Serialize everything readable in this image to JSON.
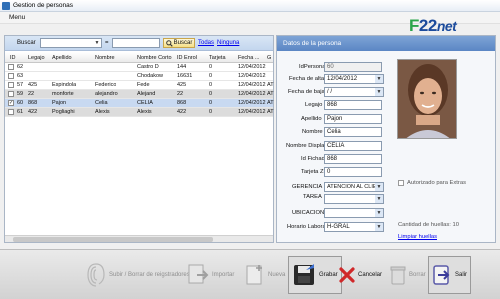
{
  "window": {
    "title": "Gestion de personas"
  },
  "menu": {
    "items": [
      "Menu"
    ]
  },
  "logo": {
    "text_f": "F",
    "text_22": "22",
    "text_net": "net"
  },
  "search": {
    "label": "Buscar",
    "field_value": "",
    "operator": "=",
    "value": "",
    "button_label": "Buscar",
    "link_all": "Todas",
    "link_none": "Ninguna"
  },
  "grid": {
    "columns": [
      "ID",
      "Legajo",
      "Apellido",
      "Nombre",
      "Nombre Corto",
      "ID Enrol",
      "Tarjeta",
      "Fecha ...",
      "G"
    ],
    "rows": [
      {
        "checked": false,
        "cells": [
          "62",
          "",
          "",
          "",
          "Castro D",
          "144",
          "0",
          "12/04/2012",
          ""
        ]
      },
      {
        "checked": false,
        "cells": [
          "63",
          "",
          "",
          "",
          "Chodakow",
          "16631",
          "0",
          "12/04/2012",
          ""
        ]
      },
      {
        "checked": false,
        "cells": [
          "57",
          "425",
          "Espindola",
          "Federico",
          "Fede",
          "425",
          "0",
          "12/04/2012",
          "AT"
        ]
      },
      {
        "checked": false,
        "cells": [
          "59",
          "22",
          "monforte",
          "alejandro",
          "Alejand",
          "22",
          "0",
          "12/04/2012",
          "AT"
        ]
      },
      {
        "checked": true,
        "cells": [
          "60",
          "868",
          "Pajon",
          "Celia",
          "CELIA",
          "868",
          "0",
          "12/04/2012",
          "AT"
        ]
      },
      {
        "checked": false,
        "cells": [
          "61",
          "422",
          "Pogliaghi",
          "Alexis",
          "Alexis",
          "422",
          "0",
          "12/04/2012",
          "AT"
        ]
      }
    ]
  },
  "detail": {
    "header": "Datos de la persona",
    "labels": {
      "id": "IdPersona",
      "alta": "Fecha de alta",
      "baja": "Fecha de baja",
      "legajo": "Legajo",
      "apellido": "Apellido",
      "nombre": "Nombre",
      "display": "Nombre Display",
      "fichada": "Id Fichada",
      "tarjeta": "Tarjeta ZK",
      "gerencia": "GERENCIA",
      "tarea": "TAREA",
      "ubicacion": "UBICACION",
      "horario": "Horario Laboral"
    },
    "values": {
      "id": "60",
      "alta": "12/04/2012",
      "baja": "  /  /",
      "legajo": "868",
      "apellido": "Pajon",
      "nombre": "Celia",
      "display": "CELIA",
      "fichada": "868",
      "tarjeta": "0",
      "gerencia": "ATENCION AL CLIEN",
      "tarea": "",
      "ubicacion": "",
      "horario": "H-GRAL"
    },
    "extras_label": "Autorizado para Extras",
    "fingerprints": "Cantidad de huellas: 10",
    "clear_fingerprints": "Limpiar huellas"
  },
  "toolbar": {
    "upload": "Subir / Borrar de reigstradores",
    "import": "Importar",
    "new": "Nueva",
    "save": "Grabar",
    "cancel": "Cancelar",
    "delete": "Borrar",
    "exit": "Salir"
  },
  "colors": {
    "header_blue": "#5b86c4",
    "selection": "#c8d9f1",
    "logo_green": "#2aa54a",
    "logo_blue": "#1c4b9c"
  }
}
